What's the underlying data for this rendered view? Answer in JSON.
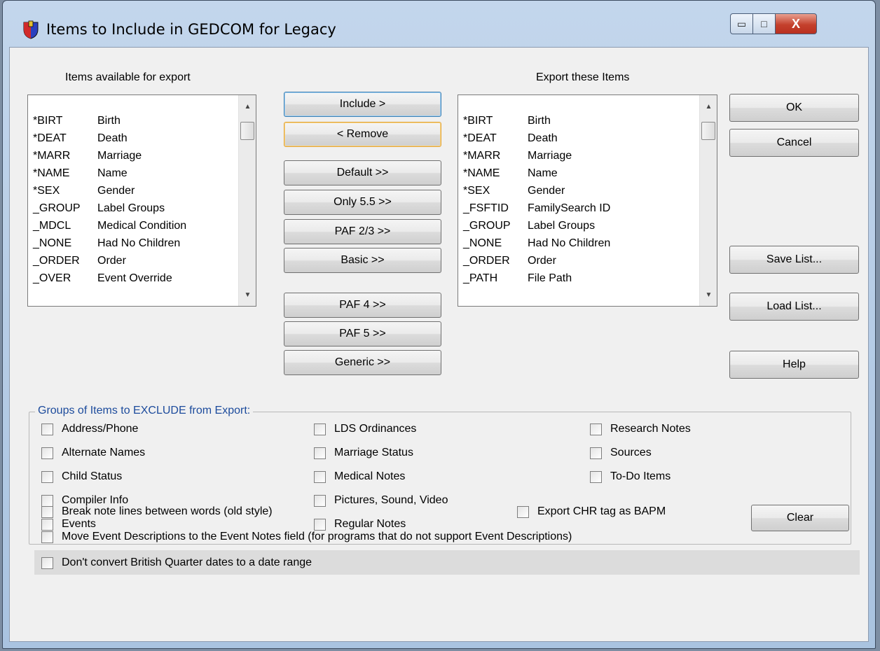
{
  "window": {
    "title": "Items to Include in GEDCOM for Legacy",
    "controls": {
      "minimize": "▭",
      "maximize": "□",
      "close": "X"
    }
  },
  "available": {
    "heading": "Items available for export",
    "items": [
      {
        "code": "*BIRT",
        "desc": "Birth"
      },
      {
        "code": "*DEAT",
        "desc": "Death"
      },
      {
        "code": "*MARR",
        "desc": "Marriage"
      },
      {
        "code": "*NAME",
        "desc": "Name"
      },
      {
        "code": "*SEX",
        "desc": "Gender"
      },
      {
        "code": "_GROUP",
        "desc": "Label Groups"
      },
      {
        "code": "_MDCL",
        "desc": "Medical Condition"
      },
      {
        "code": "_NONE",
        "desc": "Had No Children"
      },
      {
        "code": "_ORDER",
        "desc": "Order"
      },
      {
        "code": "_OVER",
        "desc": "Event Override"
      }
    ]
  },
  "exported": {
    "heading": "Export these Items",
    "items": [
      {
        "code": "*BIRT",
        "desc": "Birth"
      },
      {
        "code": "*DEAT",
        "desc": "Death"
      },
      {
        "code": "*MARR",
        "desc": "Marriage"
      },
      {
        "code": "*NAME",
        "desc": "Name"
      },
      {
        "code": "*SEX",
        "desc": "Gender"
      },
      {
        "code": "_FSFTID",
        "desc": "FamilySearch ID"
      },
      {
        "code": "_GROUP",
        "desc": "Label Groups"
      },
      {
        "code": "_NONE",
        "desc": "Had No Children"
      },
      {
        "code": "_ORDER",
        "desc": "Order"
      },
      {
        "code": "_PATH",
        "desc": "File Path"
      }
    ]
  },
  "middle_buttons": {
    "include": "Include >",
    "remove": "<  Remove",
    "default": "Default >>",
    "only55": "Only 5.5 >>",
    "paf23": "PAF 2/3 >>",
    "basic": "Basic >>",
    "paf4": "PAF 4 >>",
    "paf5": "PAF 5 >>",
    "generic": "Generic >>"
  },
  "right_buttons": {
    "ok": "OK",
    "cancel": "Cancel",
    "save": "Save List...",
    "load": "Load List...",
    "help": "Help"
  },
  "groups": {
    "title": "Groups of Items to EXCLUDE from Export:",
    "col1": [
      "Address/Phone",
      "Alternate Names",
      "Child Status",
      "Compiler Info",
      "Events"
    ],
    "col2": [
      "LDS Ordinances",
      "Marriage Status",
      "Medical Notes",
      "Pictures, Sound, Video",
      "Regular Notes"
    ],
    "col3": [
      "Research Notes",
      "Sources",
      "To-Do Items"
    ],
    "clear": "Clear"
  },
  "options": {
    "break_notes": "Break note lines between words (old style)",
    "chr_bapm": "Export CHR tag as BAPM",
    "move_desc": "Move Event Descriptions to the Event Notes field (for programs that do not support Event Descriptions)",
    "british": "Don't convert British Quarter dates to a date range"
  }
}
